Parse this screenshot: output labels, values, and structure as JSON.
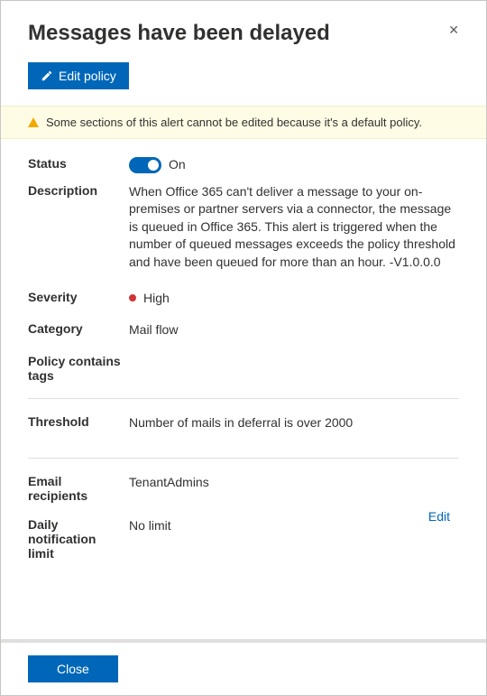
{
  "title": "Messages have been delayed",
  "toolbar": {
    "edit_policy_label": "Edit policy"
  },
  "warning": {
    "text": "Some sections of this alert cannot be edited because it's a default policy."
  },
  "fields": {
    "status": {
      "label": "Status",
      "value": "On",
      "on": true
    },
    "description": {
      "label": "Description",
      "value": "When Office 365 can't deliver a message to your on-premises or partner servers via a connector, the message is queued in Office 365. This alert is triggered when the number of queued messages exceeds the policy threshold and have been queued for more than an hour. -V1.0.0.0"
    },
    "severity": {
      "label": "Severity",
      "value": "High",
      "color": "#d13438"
    },
    "category": {
      "label": "Category",
      "value": "Mail flow"
    },
    "tags": {
      "label": "Policy contains tags",
      "value": ""
    },
    "threshold": {
      "label": "Threshold",
      "value": "Number of mails in deferral is over 2000"
    },
    "email_recipients": {
      "label": "Email recipients",
      "value": "TenantAdmins"
    },
    "daily_limit": {
      "label": "Daily notification limit",
      "value": "No limit"
    }
  },
  "actions": {
    "edit_label": "Edit",
    "close_label": "Close"
  }
}
